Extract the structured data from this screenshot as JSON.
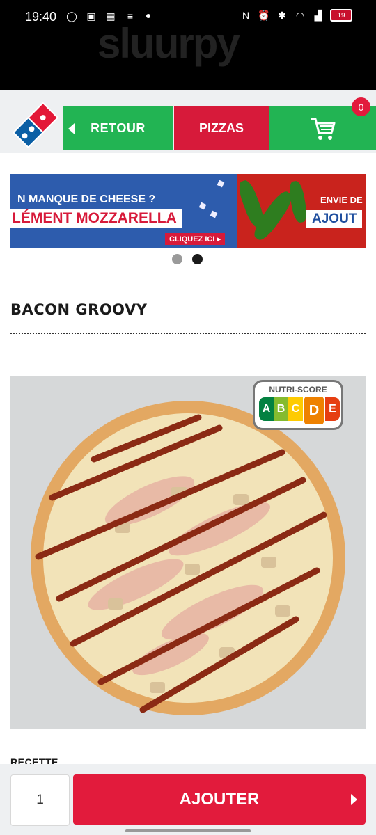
{
  "status_bar": {
    "time": "19:40",
    "battery": "19"
  },
  "header": {
    "back_label": "RETOUR",
    "pizzas_label": "PIZZAS",
    "cart_count": "0"
  },
  "banner": {
    "left_line1": "N MANQUE DE CHEESE ?",
    "left_line2": "LÉMENT MOZZARELLA",
    "left_cta": "CLIQUEZ ICI ▸",
    "right_line1": "ENVIE DE",
    "right_line2": "AJOUT"
  },
  "carousel": {
    "total": 2,
    "active_index": 1
  },
  "product": {
    "title": "BACON GROOVY",
    "nutri_score": {
      "label": "NUTRI-SCORE",
      "grades": [
        "A",
        "B",
        "C",
        "D",
        "E"
      ],
      "selected": "D"
    },
    "section_label": "RECETTE"
  },
  "order": {
    "quantity": "1",
    "add_label": "AJOUTER"
  },
  "colors": {
    "green": "#22b453",
    "red": "#d71a3a",
    "blue": "#2d5cad"
  }
}
